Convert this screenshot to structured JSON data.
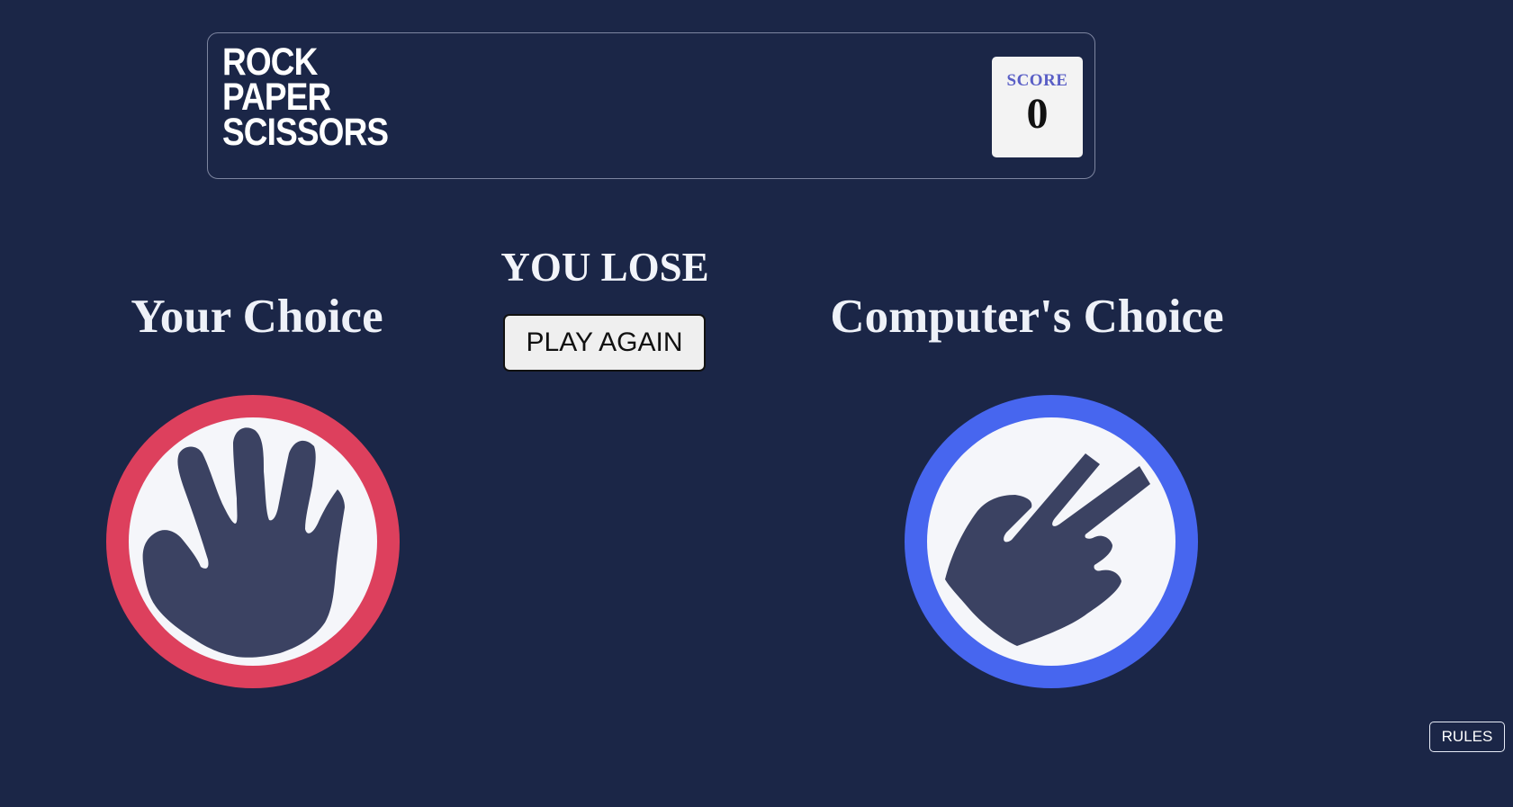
{
  "header": {
    "logo_lines": [
      "ROCK",
      "PAPER",
      "SCISSORS"
    ],
    "score_label": "SCORE",
    "score_value": "0"
  },
  "game": {
    "your_choice_title": "Your Choice",
    "computer_choice_title": "Computer's Choice",
    "result_text": "YOU LOSE",
    "play_again_label": "PLAY AGAIN",
    "your_pick": {
      "icon": "paper-hand-icon",
      "ring_color": "#dd405d"
    },
    "computer_pick": {
      "icon": "scissors-hand-icon",
      "ring_color": "#4766ef"
    }
  },
  "footer": {
    "rules_label": "RULES"
  },
  "colors": {
    "background": "#1b2647",
    "hand": "#3b4262",
    "score_label": "#5a5fc6"
  }
}
